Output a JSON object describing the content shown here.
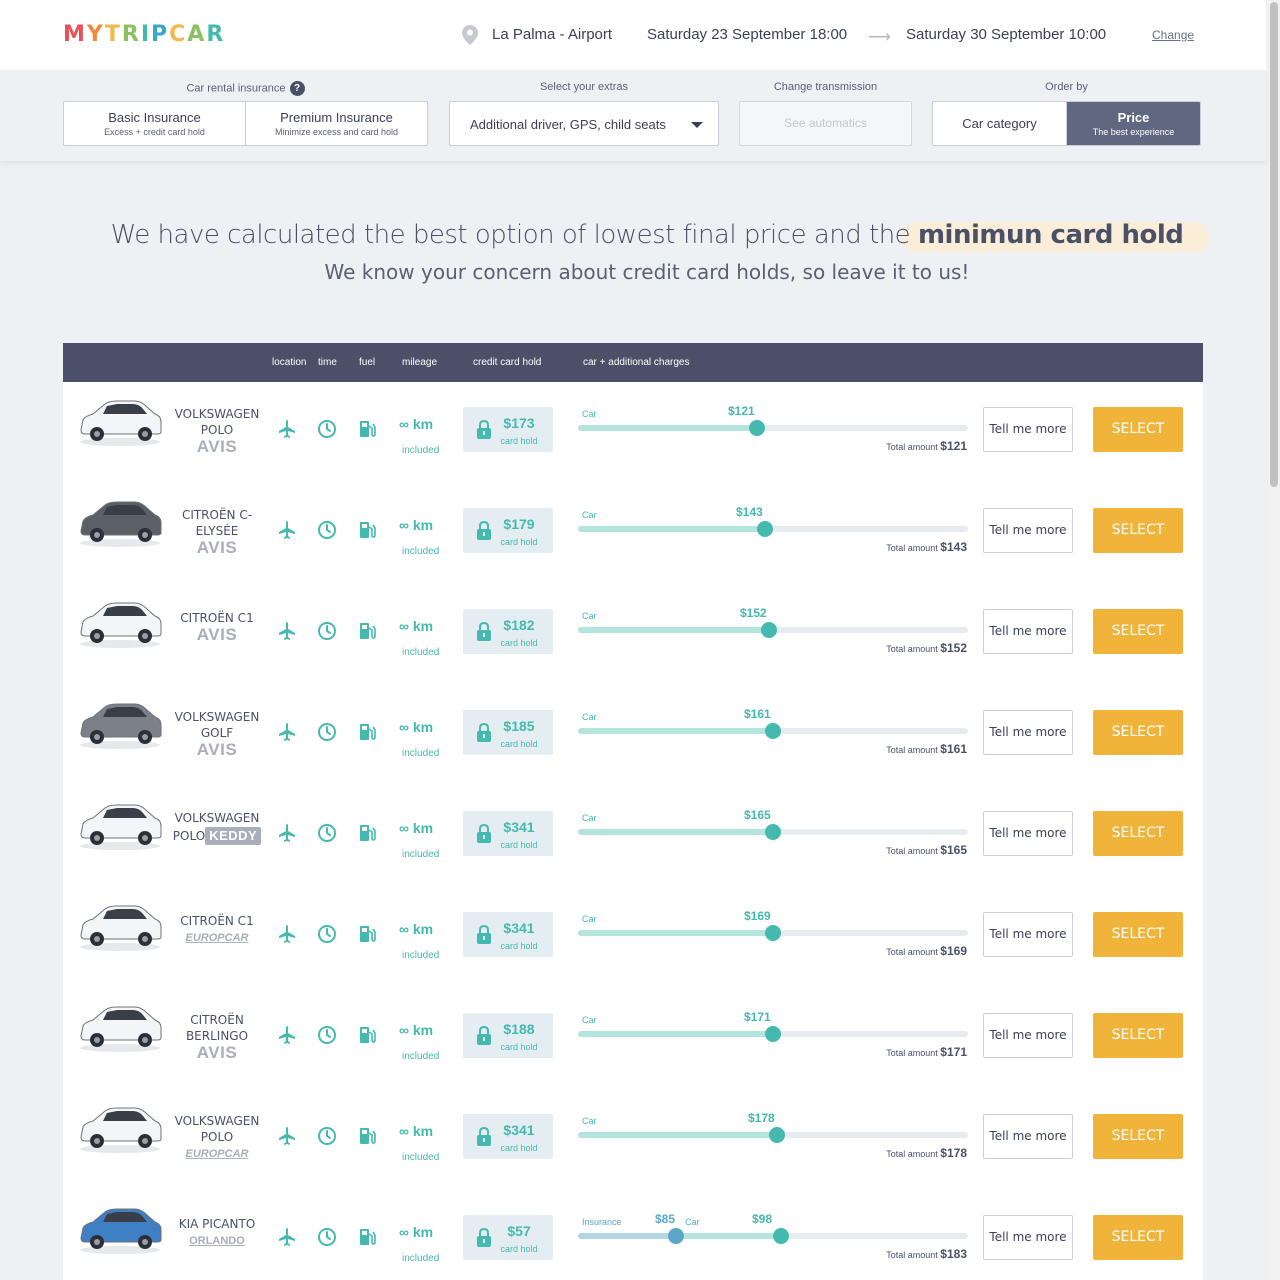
{
  "header": {
    "logo_letters": [
      {
        "ch": "M",
        "color": "#e8505b"
      },
      {
        "ch": "Y",
        "color": "#f08a3e"
      },
      {
        "ch": "T",
        "color": "#f2b84b"
      },
      {
        "ch": "R",
        "color": "#8cc063"
      },
      {
        "ch": "I",
        "color": "#45b9ae"
      },
      {
        "ch": "P",
        "color": "#3aa7c9"
      },
      {
        "ch": "C",
        "color": "#f2b84b"
      },
      {
        "ch": "A",
        "color": "#8cc063"
      },
      {
        "ch": "R",
        "color": "#45b9ae"
      }
    ],
    "location": "La Palma - Airport",
    "pickup": "Saturday 23 September 18:00",
    "dropoff": "Saturday 30 September 10:00",
    "change_label": "Change"
  },
  "filters": {
    "insurance_label": "Car rental insurance",
    "help_glyph": "?",
    "basic": {
      "title": "Basic Insurance",
      "sub": "Excess + credit card hold"
    },
    "premium": {
      "title": "Premium Insurance",
      "sub": "Minimize excess and card hold"
    },
    "extras_label": "Select your extras",
    "extras_value": "Additional driver, GPS, child seats",
    "transmission_label": "Change transmission",
    "transmission_value": "See automatics",
    "order_label": "Order by",
    "order_category": "Car category",
    "order_price": {
      "title": "Price",
      "sub": "The best experience"
    }
  },
  "headline": {
    "text": "We have calculated the best option of lowest final price and the ",
    "highlight": "minimun card hold",
    "sub": "We know your concern about credit card holds, so leave it to us!"
  },
  "table": {
    "headers": {
      "location": "location",
      "time": "time",
      "fuel": "fuel",
      "mileage": "mileage",
      "hold": "credit card hold",
      "charges": "car + additional charges"
    },
    "km_label": "∞ km",
    "included_label": "included",
    "card_hold_label": "card hold",
    "car_label": "Car",
    "insurance_label": "Insurance",
    "total_label": "Total amount",
    "tell_label": "Tell me more",
    "select_label": "SELECT",
    "rows": [
      {
        "name": "Volkswagen Polo",
        "brand": "AVIS",
        "brand_style": "avis",
        "car_color": "white",
        "hold": "$173",
        "car_price": "$121",
        "car_fraction": 0.46,
        "total": "$121"
      },
      {
        "name": "Citroën C-Elysée",
        "brand": "AVIS",
        "brand_style": "avis",
        "car_color": "dark",
        "hold": "$179",
        "car_price": "$143",
        "car_fraction": 0.48,
        "total": "$143"
      },
      {
        "name": "Citroën C1",
        "brand": "AVIS",
        "brand_style": "avis",
        "car_color": "white",
        "hold": "$182",
        "car_price": "$152",
        "car_fraction": 0.49,
        "total": "$152"
      },
      {
        "name": "Volkswagen Golf",
        "brand": "AVIS",
        "brand_style": "avis",
        "car_color": "grey",
        "hold": "$185",
        "car_price": "$161",
        "car_fraction": 0.5,
        "total": "$161"
      },
      {
        "name": "Volkswagen Polo",
        "brand": "keddy",
        "brand_style": "keddy",
        "car_color": "white",
        "hold": "$341",
        "car_price": "$165",
        "car_fraction": 0.5,
        "total": "$165"
      },
      {
        "name": "Citroën C1",
        "brand": "Europcar",
        "brand_style": "europcar",
        "car_color": "white",
        "hold": "$341",
        "car_price": "$169",
        "car_fraction": 0.5,
        "total": "$169"
      },
      {
        "name": "Citroën Berlingo",
        "brand": "AVIS",
        "brand_style": "avis",
        "car_color": "white",
        "hold": "$188",
        "car_price": "$171",
        "car_fraction": 0.5,
        "total": "$171"
      },
      {
        "name": "Volkswagen Polo",
        "brand": "Europcar",
        "brand_style": "europcar",
        "car_color": "white",
        "hold": "$341",
        "car_price": "$178",
        "car_fraction": 0.51,
        "total": "$178"
      },
      {
        "name": "Kia Picanto",
        "brand": "Orlando",
        "brand_style": "orlando",
        "car_color": "blue",
        "hold": "$57",
        "insurance_price": "$85",
        "insurance_fraction": 0.25,
        "car_price": "$98",
        "car_fraction": 0.52,
        "total": "$183"
      }
    ]
  },
  "colors": {
    "accent": "#45b9ae",
    "select": "#f0b43b",
    "header_bar": "#4a5068",
    "active_order": "#5f6781"
  }
}
